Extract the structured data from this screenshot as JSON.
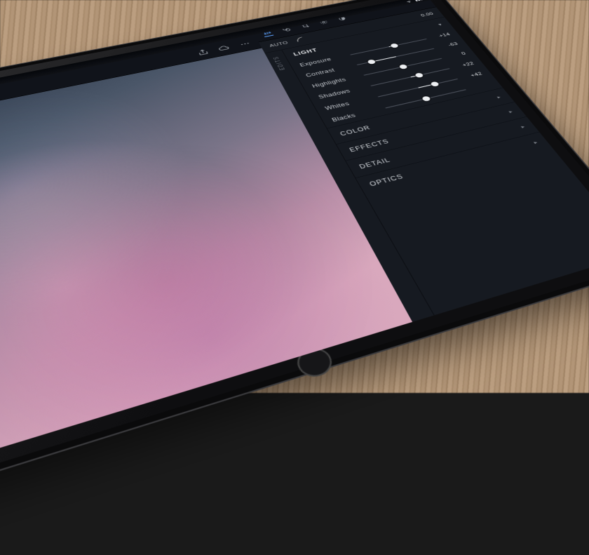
{
  "toolbar": {
    "back_icon": "back-icon",
    "undo_icon": "undo-icon",
    "redo_icon": "redo-icon",
    "share_icon": "share-icon",
    "cloud_icon": "cloud-icon",
    "more_icon": "more-icon"
  },
  "panel": {
    "top_icons": [
      "adjust-icon",
      "filter-icon",
      "crop-icon",
      "heal-icon",
      "masking-icon"
    ],
    "auto_label": "AUTO",
    "curve_value": "0.00",
    "edits_label": "EDITS",
    "sections": {
      "light": {
        "title": "LIGHT",
        "expanded": true,
        "sliders": [
          {
            "name": "Exposure",
            "value": 14,
            "display": "+14",
            "min": -100,
            "max": 100
          },
          {
            "name": "Contrast",
            "value": -63,
            "display": "-63",
            "min": -100,
            "max": 100
          },
          {
            "name": "Highlights",
            "value": 0,
            "display": "0",
            "min": -100,
            "max": 100
          },
          {
            "name": "Shadows",
            "value": 22,
            "display": "+22",
            "min": -100,
            "max": 100
          },
          {
            "name": "Whites",
            "value": 42,
            "display": "+42",
            "min": -100,
            "max": 100
          },
          {
            "name": "Blacks",
            "value": 0,
            "display": "",
            "min": -100,
            "max": 100
          }
        ]
      },
      "collapsed": [
        {
          "title": "COLOR"
        },
        {
          "title": "EFFECTS"
        },
        {
          "title": "DETAIL"
        },
        {
          "title": "OPTICS"
        }
      ]
    }
  }
}
